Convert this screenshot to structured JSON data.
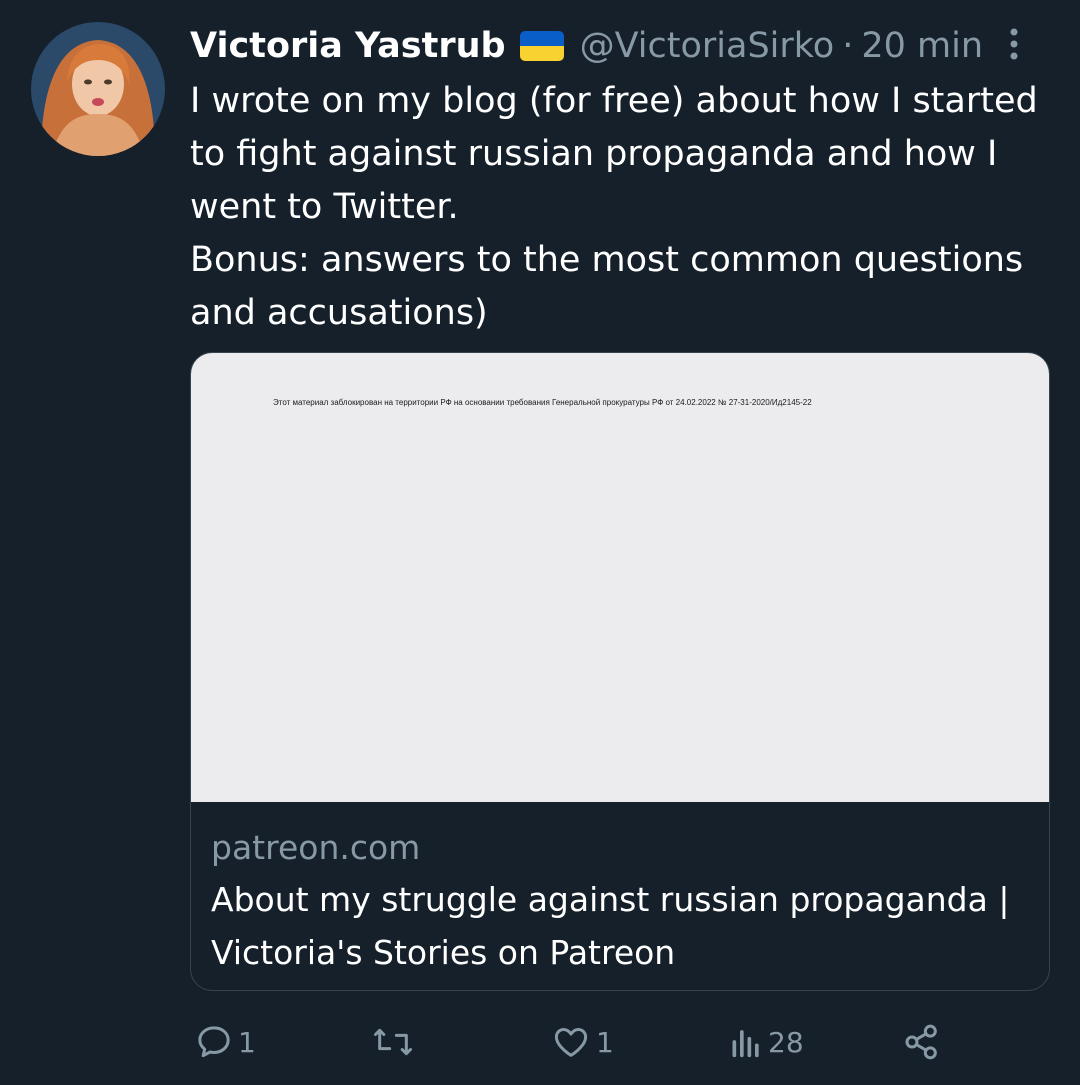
{
  "tweet": {
    "display_name": "Victoria Yastrub",
    "flag": "ukraine-flag",
    "handle": "@VictoriaSirko",
    "separator": "·",
    "time": "20 min",
    "text_lines": [
      "I wrote on my blog (for free) about how I started to fight against russian propaganda and how I went to Twitter.",
      "Bonus: answers to the most common questions and accusations)"
    ]
  },
  "card": {
    "image_caption": "Этот материал заблокирован на территории РФ на основании требования Генеральной прокуратуры РФ от 24.02.2022 № 27-31-2020/Ид2145-22",
    "domain": "patreon.com",
    "title": "About my struggle against russian propaganda | Victoria's Stories on Patreon"
  },
  "actions": {
    "reply_count": "1",
    "retweet_count": "",
    "like_count": "1",
    "views_count": "28"
  },
  "colors": {
    "background": "#15202b",
    "secondary_text": "#8899a6",
    "border": "#38444d",
    "flag_blue": "#0a5ec8",
    "flag_yellow": "#f7d230"
  }
}
